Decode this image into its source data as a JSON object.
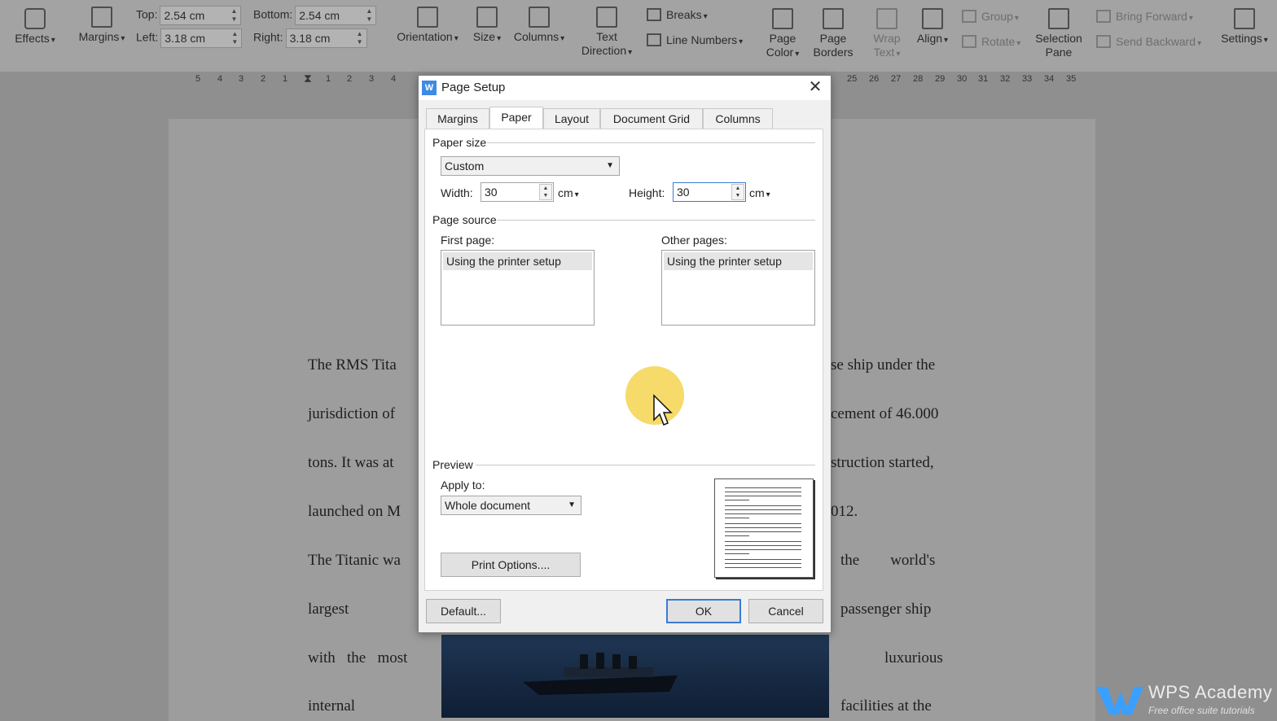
{
  "ribbon": {
    "effects": "Effects",
    "margins": "Margins",
    "top_label": "Top:",
    "top_value": "2.54 cm",
    "bottom_label": "Bottom:",
    "bottom_value": "2.54 cm",
    "left_label": "Left:",
    "left_value": "3.18 cm",
    "right_label": "Right:",
    "right_value": "3.18 cm",
    "orientation": "Orientation",
    "size": "Size",
    "columns": "Columns",
    "text_direction_1": "Text",
    "text_direction_2": "Direction",
    "breaks": "Breaks",
    "line_numbers": "Line Numbers",
    "page_color_1": "Page",
    "page_color_2": "Color",
    "page_borders_1": "Page",
    "page_borders_2": "Borders",
    "wrap_text_1": "Wrap",
    "wrap_text_2": "Text",
    "align": "Align",
    "group": "Group",
    "rotate": "Rotate",
    "selection_pane_1": "Selection",
    "selection_pane_2": "Pane",
    "bring_forward": "Bring Forward",
    "send_backward": "Send Backward",
    "settings": "Settings"
  },
  "ruler": {
    "left_ticks": [
      "5",
      "4",
      "3",
      "2",
      "1",
      "1",
      "2",
      "3",
      "4"
    ],
    "right_ticks": [
      "25",
      "26",
      "27",
      "28",
      "29",
      "30",
      "31",
      "32",
      "33",
      "34",
      "35"
    ]
  },
  "document": {
    "lines_left": [
      "The RMS Tita",
      "jurisdiction of",
      "tons. It was at",
      "launched on M",
      "The Titanic wa",
      "largest",
      "with   the   most",
      "internal"
    ],
    "lines_right": [
      "se ship under the",
      "cement of 46.000",
      "struction started,",
      "012.",
      "the        world's",
      "passenger ship",
      "luxurious",
      "facilities at the"
    ]
  },
  "dialog": {
    "title": "Page Setup",
    "close": "✕",
    "tabs": [
      "Margins",
      "Paper",
      "Layout",
      "Document Grid",
      "Columns"
    ],
    "active_tab": "Paper",
    "paper_size_group": "Paper size",
    "paper_size_value": "Custom",
    "width_label": "Width:",
    "width_value": "30",
    "width_unit": "cm",
    "height_label": "Height:",
    "height_value": "30",
    "height_unit": "cm",
    "page_source_group": "Page source",
    "first_page_label": "First page:",
    "first_page_item": "Using the printer setup",
    "other_pages_label": "Other pages:",
    "other_pages_item": "Using the printer setup",
    "preview_group": "Preview",
    "apply_to_label": "Apply to:",
    "apply_to_value": "Whole document",
    "print_options": "Print Options....",
    "default_btn": "Default...",
    "ok_btn": "OK",
    "cancel_btn": "Cancel"
  },
  "watermark": {
    "title": "WPS Academy",
    "subtitle": "Free office suite tutorials"
  }
}
